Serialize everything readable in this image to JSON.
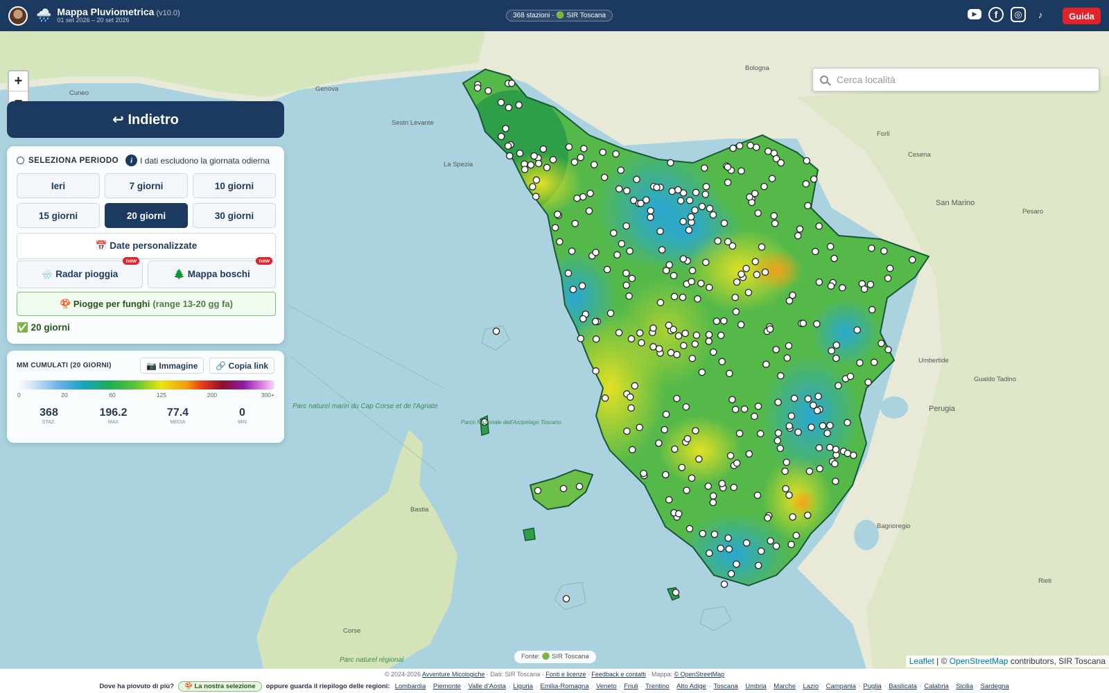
{
  "header": {
    "title": "Mappa Pluviometrica",
    "version": "(v10.0)",
    "date_range": "01 set 2026 – 20 set 2026",
    "stations_pill": "368 stazioni · 🟢 SIR Toscana",
    "social_icons": [
      "youtube-icon",
      "facebook-icon",
      "instagram-icon",
      "tiktok-icon"
    ],
    "guide_label": "Guida",
    "accent_color": "#1c3a60",
    "guide_color": "#e3222b"
  },
  "map": {
    "zoom_in": "+",
    "zoom_out": "−",
    "search_placeholder": "Cerca località",
    "place_labels": [
      "Cuneo",
      "Genova",
      "Sestri Levante",
      "La Spezia",
      "Bologna",
      "Cesena",
      "Forlì",
      "San Marino",
      "Pesaro",
      "Perugia",
      "Umbertide",
      "Gualdo Tadino",
      "Bagnoregio",
      "Rieti",
      "Bastia",
      "Corse",
      "Parc naturel marin du Cap Corse et de l'Agriate",
      "Parco Nazionale dell'Arcipelago Toscano",
      "Parc naturel régional"
    ],
    "source_chip": "Fonte: 🟢 SIR Toscana",
    "attribution_leaflet": "Leaflet",
    "attribution_osm": "OpenStreetMap",
    "attribution_rest": "contributors, SIR Toscana"
  },
  "panel": {
    "back_label": "↩ Indietro",
    "period_title": "SELEZIONA PERIODO",
    "period_note": "I dati escludono la giornata odierna",
    "periods": [
      "Ieri",
      "7 giorni",
      "10 giorni",
      "15 giorni",
      "20 giorni",
      "30 giorni"
    ],
    "active_period": "20 giorni",
    "custom_dates": "📅 Date personalizzate",
    "radar_label": "🌧️ Radar pioggia",
    "boschi_label": "🌲 Mappa boschi",
    "new_badge": "new",
    "funghi_label": "🍄 Piogge per funghi",
    "funghi_range": "(range 13-20 gg fa)",
    "selected_label": "✅ 20 giorni"
  },
  "legend": {
    "title": "MM CUMULATI (20 GIORNI)",
    "image_button": "📷 Immagine",
    "copy_link_button": "🔗 Copia link",
    "ticks": [
      "0",
      "20",
      "60",
      "125",
      "200",
      "300+"
    ],
    "stats": [
      {
        "value": "368",
        "label": "STAZ."
      },
      {
        "value": "196.2",
        "label": "MAX"
      },
      {
        "value": "77.4",
        "label": "MEDIA"
      },
      {
        "value": "0",
        "label": "MIN"
      }
    ]
  },
  "footer": {
    "copyright": "© 2024-2026",
    "site_link": "Avventure Micologiche",
    "data_note": "· Dati: SIR Toscana ·",
    "links": [
      "Fonti e licenze",
      "Feedback e contatti"
    ],
    "map_note": "· Mappa:",
    "map_link": "© OpenStreetMap",
    "question": "Dove ha piovuto di più?",
    "selection_chip": "🍄 La nostra selezione",
    "regions_intro": "oppure guarda il riepilogo delle regioni:",
    "regions": [
      "Lombardia",
      "Piemonte",
      "Valle d'Aosta",
      "Liguria",
      "Emilia-Romagna",
      "Veneto",
      "Friuli",
      "Trentino",
      "Alto Adige",
      "Toscana",
      "Umbria",
      "Marche",
      "Lazio",
      "Campania",
      "Puglia",
      "Basilicata",
      "Calabria",
      "Sicilia",
      "Sardegna"
    ]
  }
}
